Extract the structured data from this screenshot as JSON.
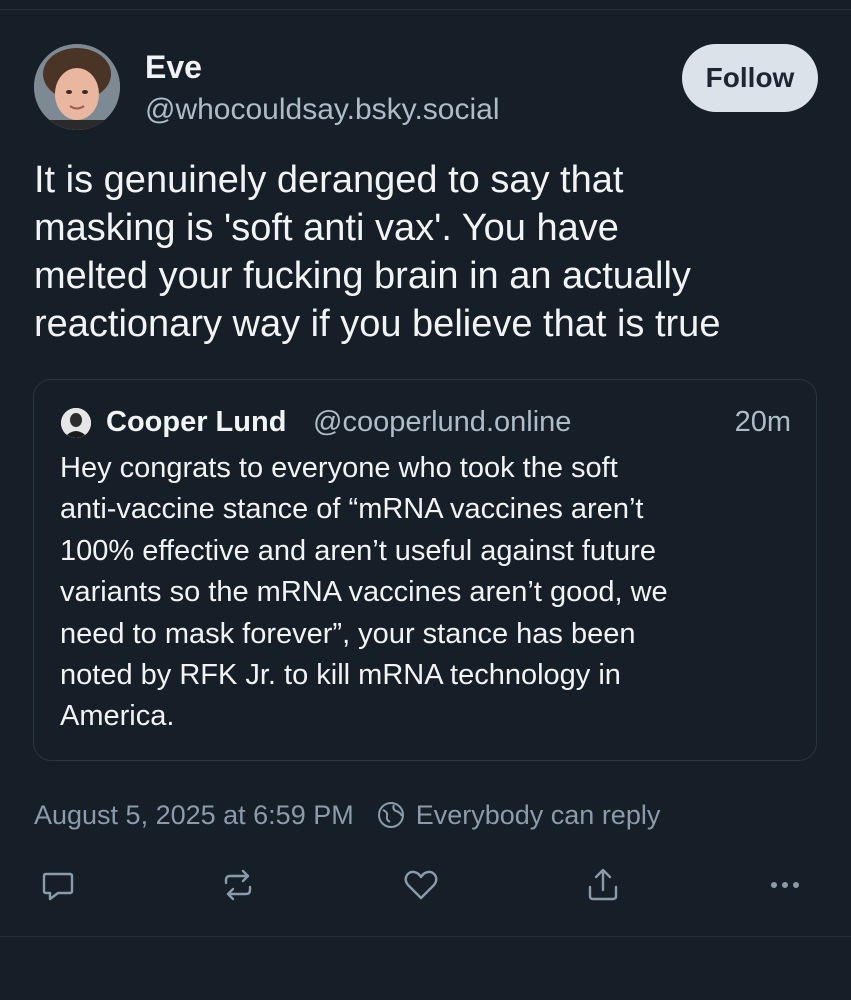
{
  "post": {
    "author_name": "Eve",
    "author_handle": "@whocouldsay.bsky.social",
    "follow_label": "Follow",
    "text": "It is genuinely deranged to say that\nmasking is 'soft anti vax'. You have\nmelted your fucking brain in an actually\nreactionary way if you believe that is true",
    "timestamp": "August 5, 2025 at 6:59 PM",
    "reply_setting": "Everybody can reply"
  },
  "quote": {
    "author_name": "Cooper Lund",
    "author_handle": "@cooperlund.online",
    "time_ago": "20m",
    "text": "Hey congrats to everyone who took the soft\nanti-vaccine stance of “mRNA vaccines aren’t\n100% effective and aren’t useful against future\nvariants so the mRNA vaccines aren’t good, we\nneed to mask forever”, your stance has been\nnoted by RFK Jr. to kill mRNA technology in\nAmerica."
  },
  "actions": {
    "icons": [
      "reply-icon",
      "repost-icon",
      "like-icon",
      "share-icon",
      "more-icon"
    ]
  },
  "colors": {
    "background": "#161e27",
    "text": "#f1f3f5",
    "muted": "#8c9bab",
    "handle": "#aebbc9",
    "follow_bg": "#dce2ea"
  }
}
